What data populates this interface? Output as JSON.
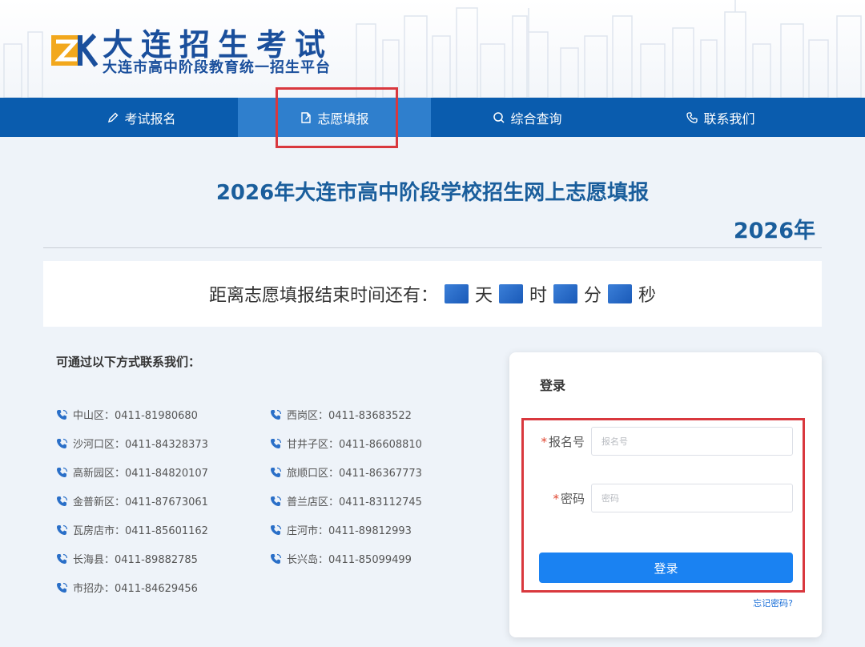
{
  "header": {
    "site_title": "大连招生考试",
    "site_subtitle": "大连市高中阶段教育统一招生平台"
  },
  "nav": {
    "items": [
      {
        "label": "考试报名",
        "icon": "pencil-icon"
      },
      {
        "label": "志愿填报",
        "icon": "document-edit-icon",
        "active": true
      },
      {
        "label": "综合查询",
        "icon": "search-icon"
      },
      {
        "label": "联系我们",
        "icon": "phone-icon"
      }
    ]
  },
  "main": {
    "title": "2026年大连市高中阶段学校招生网上志愿填报",
    "year": "2026年"
  },
  "countdown": {
    "prefix": "距离志愿填报结束时间还有：",
    "day": "天",
    "hour": "时",
    "minute": "分",
    "second": "秒"
  },
  "contacts": {
    "heading": "可通过以下方式联系我们：",
    "left": [
      "中山区：0411-81980680",
      "沙河口区：0411-84328373",
      "高新园区：0411-84820107",
      "金普新区：0411-87673061",
      "瓦房店市：0411-85601162",
      "长海县：0411-89882785",
      "市招办：0411-84629456"
    ],
    "right": [
      "西岗区：0411-83683522",
      "甘井子区：0411-86608810",
      "旅顺口区：0411-86367773",
      "普兰店区：0411-83112745",
      "庄河市：0411-89812993",
      "长兴岛：0411-85099499"
    ]
  },
  "login": {
    "heading": "登录",
    "required_mark": "*",
    "username_label": "报名号",
    "username_placeholder": "报名号",
    "password_label": "密码",
    "password_placeholder": "密码",
    "submit_label": "登录",
    "forgot_label": "忘记密码?"
  },
  "colors": {
    "nav_bg": "#0a5cae",
    "nav_active": "#2f7fcd",
    "title_blue": "#1a5e9c",
    "button_blue": "#1a82f2",
    "highlight_red": "#d9383e"
  }
}
